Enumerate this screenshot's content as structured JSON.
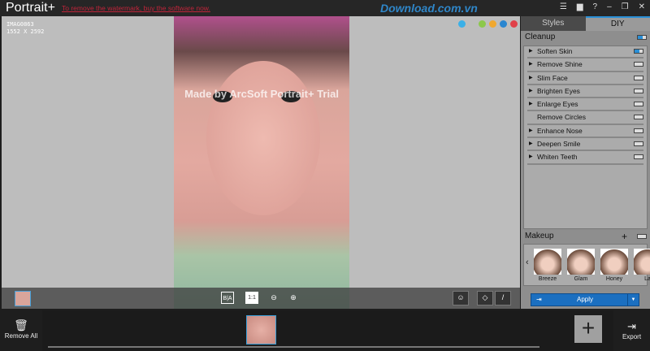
{
  "app": {
    "title": "Portrait+",
    "promo": "To remove the watermark, buy the software now.",
    "site_watermark": "Download.com.vn"
  },
  "image": {
    "name": "IMAG0863",
    "size": "1552 X 2592",
    "watermark": "Made by ArcSoft Portrait+ Trial"
  },
  "color_dots": [
    "#3ab0e8",
    "#8cc84b",
    "#f0a830",
    "#2a86d0",
    "#e04048"
  ],
  "toolbar": {
    "before_after": "B|A",
    "actual": "1:1"
  },
  "tabs": [
    {
      "label": "Styles"
    },
    {
      "label": "DIY"
    }
  ],
  "cleanup": {
    "title": "Cleanup",
    "items": [
      {
        "label": "Soften Skin",
        "on": true,
        "expand": true
      },
      {
        "label": "Remove Shine",
        "on": false,
        "expand": true
      },
      {
        "label": "Slim Face",
        "on": false,
        "expand": true
      },
      {
        "label": "Brighten Eyes",
        "on": false,
        "expand": true
      },
      {
        "label": "Enlarge Eyes",
        "on": false,
        "expand": true
      },
      {
        "label": "Remove Circles",
        "on": false,
        "expand": false
      },
      {
        "label": "Enhance Nose",
        "on": false,
        "expand": true
      },
      {
        "label": "Deepen Smile",
        "on": false,
        "expand": true
      },
      {
        "label": "Whiten Teeth",
        "on": false,
        "expand": true
      }
    ]
  },
  "makeup": {
    "title": "Makeup",
    "add": "+",
    "presets": [
      "Breeze",
      "Glam",
      "Honey",
      "La"
    ],
    "prev": "‹",
    "next": "›"
  },
  "apply": {
    "label": "Apply"
  },
  "footer": {
    "remove_all": "Remove All",
    "export": "Export",
    "add": "+"
  }
}
